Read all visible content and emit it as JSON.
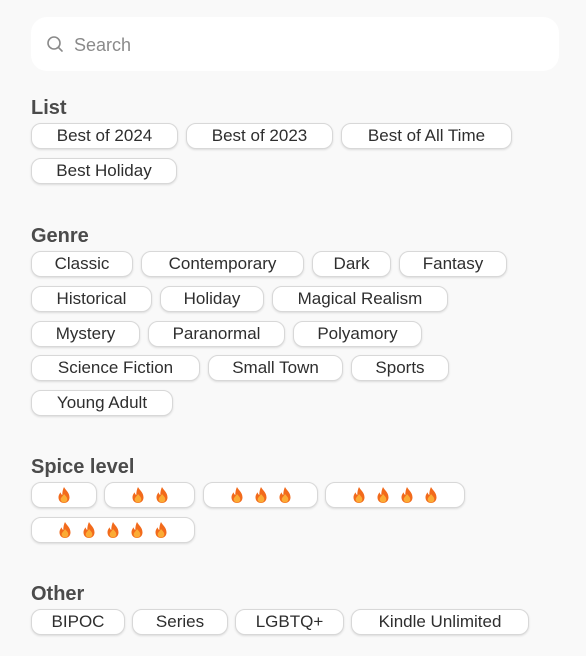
{
  "search": {
    "placeholder": "Search",
    "value": "",
    "icon": "search-icon"
  },
  "sections": {
    "list": {
      "title": "List",
      "items": [
        "Best of 2024",
        "Best of 2023",
        "Best of All Time",
        "Best Holiday"
      ]
    },
    "genre": {
      "title": "Genre",
      "items": [
        "Classic",
        "Contemporary",
        "Dark",
        "Fantasy",
        "Historical",
        "Holiday",
        "Magical Realism",
        "Mystery",
        "Paranormal",
        "Polyamory",
        "Science Fiction",
        "Small Town",
        "Sports",
        "Young Adult"
      ]
    },
    "spice": {
      "title": "Spice level",
      "icon": "flame-icon",
      "levels": [
        1,
        2,
        3,
        4,
        5
      ]
    },
    "other": {
      "title": "Other",
      "items": [
        "BIPOC",
        "Series",
        "LGBTQ+",
        "Kindle Unlimited"
      ]
    }
  },
  "colors": {
    "flame_outer": "#f26a1b",
    "flame_inner": "#fbab35",
    "background": "#f9f9f9"
  }
}
